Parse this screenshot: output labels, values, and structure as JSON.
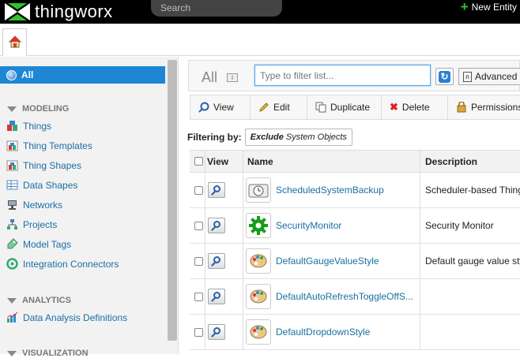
{
  "header": {
    "brand": "thingworx",
    "search_placeholder": "Search",
    "new_entity_label": "New Entity"
  },
  "sidebar": {
    "all_label": "All",
    "sections": {
      "modeling": "MODELING",
      "analytics": "ANALYTICS",
      "visualization": "VISUALIZATION"
    },
    "modeling_items": [
      {
        "label": "Things",
        "icon": "things-icon"
      },
      {
        "label": "Thing Templates",
        "icon": "thing-templates-icon"
      },
      {
        "label": "Thing Shapes",
        "icon": "thing-shapes-icon"
      },
      {
        "label": "Data Shapes",
        "icon": "data-shapes-icon"
      },
      {
        "label": "Networks",
        "icon": "networks-icon"
      },
      {
        "label": "Projects",
        "icon": "projects-icon"
      },
      {
        "label": "Model Tags",
        "icon": "model-tags-icon"
      },
      {
        "label": "Integration Connectors",
        "icon": "integration-connectors-icon"
      }
    ],
    "analytics_items": [
      {
        "label": "Data Analysis Definitions",
        "icon": "analysis-icon"
      }
    ]
  },
  "filter": {
    "all_label": "All",
    "input_placeholder": "Type to filter list...",
    "advanced_label": "Advanced"
  },
  "toolbar": {
    "view": "View",
    "edit": "Edit",
    "duplicate": "Duplicate",
    "delete": "Delete",
    "permissions": "Permissions"
  },
  "filtering": {
    "label": "Filtering by:",
    "chip_bold": "Exclude",
    "chip_rest": " System Objects"
  },
  "grid": {
    "headers": {
      "view": "View",
      "name": "Name",
      "description": "Description"
    },
    "rows": [
      {
        "name": "ScheduledSystemBackup",
        "description": "Scheduler-based Thing",
        "icon": "scheduler-icon"
      },
      {
        "name": "SecurityMonitor",
        "description": "Security Monitor",
        "icon": "gear-icon"
      },
      {
        "name": "DefaultGaugeValueStyle",
        "description": "Default gauge value style",
        "icon": "palette-icon"
      },
      {
        "name": "DefaultAutoRefreshToggleOffS...",
        "description": "",
        "icon": "palette-icon"
      },
      {
        "name": "DefaultDropdownStyle",
        "description": "",
        "icon": "palette-icon"
      }
    ]
  }
}
